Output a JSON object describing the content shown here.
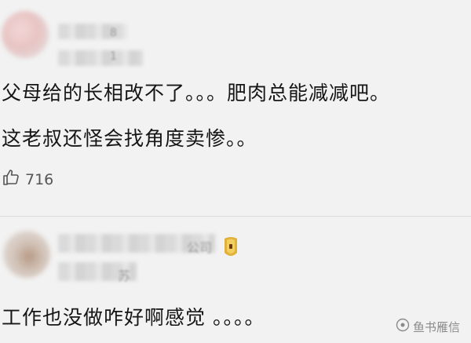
{
  "comments": [
    {
      "name_tail": "8",
      "meta_tail": "1",
      "lines": [
        "父母给的长相改不了。。。肥肉总能减减吧。",
        "这老叔还怪会找角度卖惨。。"
      ],
      "like_count": "716"
    },
    {
      "name_tail": "公司",
      "meta_tail": "苏",
      "lines": [
        "工作也没做咋好啊感觉 。。。。"
      ]
    }
  ],
  "watermark": {
    "text": "鱼书雁信"
  },
  "colors": {
    "background": "#f2f2f2",
    "text": "#161616",
    "meta": "#8a8a8a",
    "badge": "#e0b23a"
  }
}
